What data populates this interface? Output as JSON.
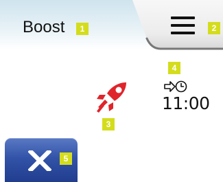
{
  "header": {
    "title": "Boost",
    "title_badge": "1"
  },
  "menu": {
    "icon": "hamburger-menu-icon",
    "badge": "2"
  },
  "mode": {
    "icon": "rocket-icon",
    "badge": "3",
    "color": "#e0242b"
  },
  "timer": {
    "icon": "boost-end-timer-icon",
    "badge": "4",
    "end_time": "11:00"
  },
  "cancel": {
    "icon": "close-x-icon",
    "badge": "5",
    "color": "#3253a8"
  },
  "colors": {
    "badge": "#d4dd1c",
    "header_gradient": "#cfe4ee"
  }
}
